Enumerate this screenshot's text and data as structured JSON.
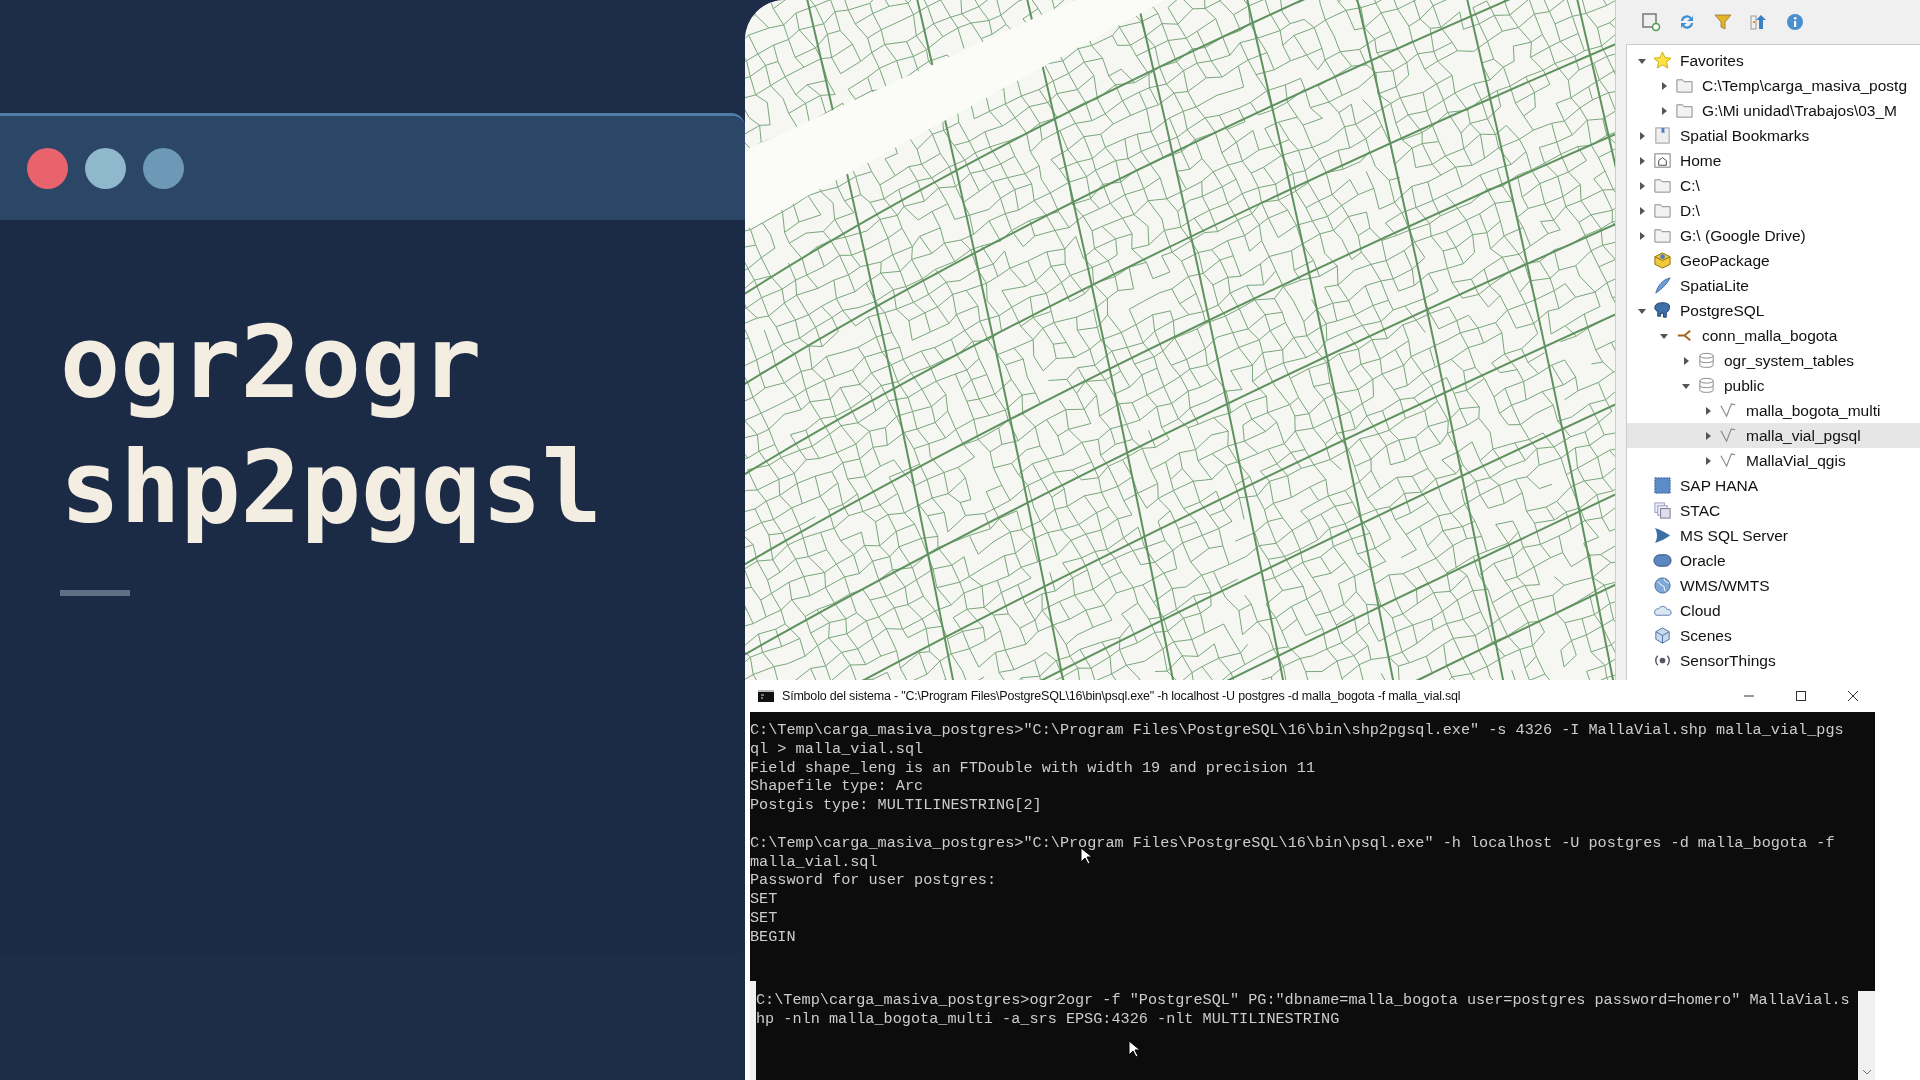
{
  "slide": {
    "dots": [
      {
        "color": "#e8636b"
      },
      {
        "color": "#8fb8cc"
      },
      {
        "color": "#6d98b6"
      }
    ],
    "title_lines": [
      "ogr2ogr",
      "shp2pgqsl"
    ]
  },
  "browser": {
    "toolbar": [
      {
        "kind": "add"
      },
      {
        "kind": "refresh"
      },
      {
        "kind": "filter"
      },
      {
        "kind": "collapse"
      },
      {
        "kind": "info"
      }
    ],
    "tree": [
      {
        "label": "Favorites",
        "kind": "star",
        "expanded": true,
        "selected": false,
        "children": [
          {
            "label": "C:\\Temp\\carga_masiva_postg",
            "kind": "folder",
            "expanded": false,
            "selected": false
          },
          {
            "label": "G:\\Mi unidad\\Trabajos\\03_M",
            "kind": "folder",
            "expanded": false,
            "selected": false
          }
        ]
      },
      {
        "label": "Spatial Bookmarks",
        "kind": "bookmark",
        "expanded": false,
        "selected": false
      },
      {
        "label": "Home",
        "kind": "home",
        "expanded": false,
        "selected": false
      },
      {
        "label": "C:\\",
        "kind": "folder",
        "expanded": false,
        "selected": false
      },
      {
        "label": "D:\\",
        "kind": "folder",
        "expanded": false,
        "selected": false
      },
      {
        "label": "G:\\ (Google Drive)",
        "kind": "folder",
        "expanded": false,
        "selected": false
      },
      {
        "label": "GeoPackage",
        "kind": "geopackage",
        "selected": false
      },
      {
        "label": "SpatiaLite",
        "kind": "feather",
        "selected": false
      },
      {
        "label": "PostgreSQL",
        "kind": "elephant",
        "expanded": true,
        "selected": false,
        "children": [
          {
            "label": "conn_malla_bogota",
            "kind": "connection",
            "expanded": true,
            "selected": false,
            "children": [
              {
                "label": "ogr_system_tables",
                "kind": "schema",
                "expanded": false,
                "selected": false
              },
              {
                "label": "public",
                "kind": "schema",
                "expanded": true,
                "selected": false,
                "children": [
                  {
                    "label": "malla_bogota_multi",
                    "kind": "line",
                    "expanded": false,
                    "selected": false
                  },
                  {
                    "label": "malla_vial_pgsql",
                    "kind": "line",
                    "expanded": false,
                    "selected": true
                  },
                  {
                    "label": "MallaVial_qgis",
                    "kind": "line",
                    "expanded": false,
                    "selected": false
                  }
                ]
              }
            ]
          }
        ]
      },
      {
        "label": "SAP HANA",
        "kind": "chip",
        "selected": false
      },
      {
        "label": "STAC",
        "kind": "stack",
        "selected": false
      },
      {
        "label": "MS SQL Server",
        "kind": "sail",
        "selected": false
      },
      {
        "label": "Oracle",
        "kind": "pill",
        "selected": false
      },
      {
        "label": "WMS/WMTS",
        "kind": "globe",
        "selected": false
      },
      {
        "label": "Cloud",
        "kind": "cloud",
        "selected": false
      },
      {
        "label": "Scenes",
        "kind": "cube",
        "selected": false
      },
      {
        "label": "SensorThings",
        "kind": "signal",
        "selected": false
      }
    ]
  },
  "terminal": {
    "title": "Símbolo del sistema - \"C:\\Program Files\\PostgreSQL\\16\\bin\\psql.exe\"  -h localhost -U postgres -d malla_bogota -f malla_vial.sql",
    "sections": [
      {
        "paragraphs": [
          [
            "C:\\Temp\\carga_masiva_postgres>\"C:\\Program Files\\PostgreSQL\\16\\bin\\shp2pgsql.exe\" -s 4326 -I MallaVial.shp malla_vial_pgs",
            "ql > malla_vial.sql",
            "Field shape_leng is an FTDouble with width 19 and precision 11",
            "Shapefile type: Arc",
            "Postgis type: MULTILINESTRING[2]"
          ],
          [
            "C:\\Temp\\carga_masiva_postgres>\"C:\\Program Files\\PostgreSQL\\16\\bin\\psql.exe\" -h localhost -U postgres -d malla_bogota -f",
            "malla_vial.sql",
            "Password for user postgres:",
            "SET",
            "SET",
            "BEGIN"
          ]
        ]
      },
      {
        "paragraphs": [
          [
            "C:\\Temp\\carga_masiva_postgres>ogr2ogr -f \"PostgreSQL\" PG:\"dbname=malla_bogota user=postgres password=homero\" MallaVial.s",
            "hp -nln malla_bogota_multi -a_srs EPSG:4326 -nlt MULTILINESTRING"
          ]
        ]
      }
    ]
  }
}
